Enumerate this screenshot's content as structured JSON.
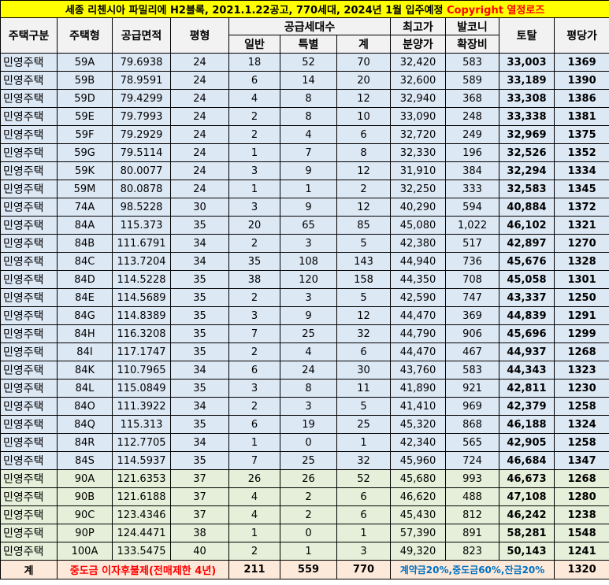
{
  "title": {
    "text": "세종 리첸시아 파밀리에 H2블록, 2021.1.22공고, 770세대, 2024년 1월 입주예정",
    "copyright": "Copyright 열정로즈"
  },
  "header": {
    "type": "주택구분",
    "model": "주택형",
    "area": "공급면적",
    "pyeong": "평형",
    "units": "공급세대수",
    "general": "일반",
    "special": "특별",
    "total_units": "계",
    "max_price_1": "최고가",
    "max_price_2": "분양가",
    "balcony_1": "발코니",
    "balcony_2": "확장비",
    "total": "토탈",
    "per_pyeong": "평당가"
  },
  "rows": [
    {
      "type": "민영주택",
      "model": "59A",
      "area": "79.6938",
      "pyeong": "24",
      "general": "18",
      "special": "52",
      "units": "70",
      "max_price": "32,420",
      "balcony": "583",
      "total": "33,003",
      "per_pyeong": "1369"
    },
    {
      "type": "민영주택",
      "model": "59B",
      "area": "78.9591",
      "pyeong": "24",
      "general": "6",
      "special": "14",
      "units": "20",
      "max_price": "32,600",
      "balcony": "589",
      "total": "33,189",
      "per_pyeong": "1390"
    },
    {
      "type": "민영주택",
      "model": "59D",
      "area": "79.4299",
      "pyeong": "24",
      "general": "4",
      "special": "8",
      "units": "12",
      "max_price": "32,940",
      "balcony": "368",
      "total": "33,308",
      "per_pyeong": "1386"
    },
    {
      "type": "민영주택",
      "model": "59E",
      "area": "79.7993",
      "pyeong": "24",
      "general": "2",
      "special": "8",
      "units": "10",
      "max_price": "33,090",
      "balcony": "248",
      "total": "33,338",
      "per_pyeong": "1381"
    },
    {
      "type": "민영주택",
      "model": "59F",
      "area": "79.2929",
      "pyeong": "24",
      "general": "2",
      "special": "4",
      "units": "6",
      "max_price": "32,720",
      "balcony": "249",
      "total": "32,969",
      "per_pyeong": "1375"
    },
    {
      "type": "민영주택",
      "model": "59G",
      "area": "79.5114",
      "pyeong": "24",
      "general": "1",
      "special": "7",
      "units": "8",
      "max_price": "32,330",
      "balcony": "196",
      "total": "32,526",
      "per_pyeong": "1352"
    },
    {
      "type": "민영주택",
      "model": "59K",
      "area": "80.0077",
      "pyeong": "24",
      "general": "3",
      "special": "9",
      "units": "12",
      "max_price": "31,910",
      "balcony": "384",
      "total": "32,294",
      "per_pyeong": "1334"
    },
    {
      "type": "민영주택",
      "model": "59M",
      "area": "80.0878",
      "pyeong": "24",
      "general": "1",
      "special": "1",
      "units": "2",
      "max_price": "32,250",
      "balcony": "333",
      "total": "32,583",
      "per_pyeong": "1345"
    },
    {
      "type": "민영주택",
      "model": "74A",
      "area": "98.5228",
      "pyeong": "30",
      "general": "3",
      "special": "9",
      "units": "12",
      "max_price": "40,290",
      "balcony": "594",
      "total": "40,884",
      "per_pyeong": "1372"
    },
    {
      "type": "민영주택",
      "model": "84A",
      "area": "115.373",
      "pyeong": "35",
      "general": "20",
      "special": "65",
      "units": "85",
      "max_price": "45,080",
      "balcony": "1,022",
      "total": "46,102",
      "per_pyeong": "1321"
    },
    {
      "type": "민영주택",
      "model": "84B",
      "area": "111.6791",
      "pyeong": "34",
      "general": "2",
      "special": "3",
      "units": "5",
      "max_price": "42,380",
      "balcony": "517",
      "total": "42,897",
      "per_pyeong": "1270"
    },
    {
      "type": "민영주택",
      "model": "84C",
      "area": "113.7204",
      "pyeong": "34",
      "general": "35",
      "special": "108",
      "units": "143",
      "max_price": "44,940",
      "balcony": "736",
      "total": "45,676",
      "per_pyeong": "1328"
    },
    {
      "type": "민영주택",
      "model": "84D",
      "area": "114.5228",
      "pyeong": "35",
      "general": "38",
      "special": "120",
      "units": "158",
      "max_price": "44,350",
      "balcony": "708",
      "total": "45,058",
      "per_pyeong": "1301"
    },
    {
      "type": "민영주택",
      "model": "84E",
      "area": "114.5689",
      "pyeong": "35",
      "general": "2",
      "special": "3",
      "units": "5",
      "max_price": "42,590",
      "balcony": "747",
      "total": "43,337",
      "per_pyeong": "1250"
    },
    {
      "type": "민영주택",
      "model": "84G",
      "area": "114.8389",
      "pyeong": "35",
      "general": "3",
      "special": "9",
      "units": "12",
      "max_price": "44,470",
      "balcony": "369",
      "total": "44,839",
      "per_pyeong": "1291"
    },
    {
      "type": "민영주택",
      "model": "84H",
      "area": "116.3208",
      "pyeong": "35",
      "general": "7",
      "special": "25",
      "units": "32",
      "max_price": "44,790",
      "balcony": "906",
      "total": "45,696",
      "per_pyeong": "1299"
    },
    {
      "type": "민영주택",
      "model": "84I",
      "area": "117.1747",
      "pyeong": "35",
      "general": "2",
      "special": "4",
      "units": "6",
      "max_price": "44,470",
      "balcony": "467",
      "total": "44,937",
      "per_pyeong": "1268"
    },
    {
      "type": "민영주택",
      "model": "84K",
      "area": "110.7965",
      "pyeong": "34",
      "general": "6",
      "special": "24",
      "units": "30",
      "max_price": "43,760",
      "balcony": "583",
      "total": "44,343",
      "per_pyeong": "1323"
    },
    {
      "type": "민영주택",
      "model": "84L",
      "area": "115.0849",
      "pyeong": "35",
      "general": "3",
      "special": "8",
      "units": "11",
      "max_price": "41,890",
      "balcony": "921",
      "total": "42,811",
      "per_pyeong": "1230"
    },
    {
      "type": "민영주택",
      "model": "84O",
      "area": "111.3922",
      "pyeong": "34",
      "general": "2",
      "special": "3",
      "units": "5",
      "max_price": "41,410",
      "balcony": "969",
      "total": "42,379",
      "per_pyeong": "1258"
    },
    {
      "type": "민영주택",
      "model": "84Q",
      "area": "115.313",
      "pyeong": "35",
      "general": "6",
      "special": "19",
      "units": "25",
      "max_price": "45,320",
      "balcony": "868",
      "total": "46,188",
      "per_pyeong": "1324"
    },
    {
      "type": "민영주택",
      "model": "84R",
      "area": "112.7705",
      "pyeong": "34",
      "general": "1",
      "special": "0",
      "units": "1",
      "max_price": "42,340",
      "balcony": "565",
      "total": "42,905",
      "per_pyeong": "1258"
    },
    {
      "type": "민영주택",
      "model": "84S",
      "area": "114.5937",
      "pyeong": "35",
      "general": "7",
      "special": "25",
      "units": "32",
      "max_price": "45,960",
      "balcony": "724",
      "total": "46,684",
      "per_pyeong": "1347"
    },
    {
      "type": "민영주택",
      "model": "90A",
      "area": "121.6353",
      "pyeong": "37",
      "general": "26",
      "special": "26",
      "units": "52",
      "max_price": "45,680",
      "balcony": "993",
      "total": "46,673",
      "per_pyeong": "1268"
    },
    {
      "type": "민영주택",
      "model": "90B",
      "area": "121.6188",
      "pyeong": "37",
      "general": "4",
      "special": "2",
      "units": "6",
      "max_price": "46,620",
      "balcony": "488",
      "total": "47,108",
      "per_pyeong": "1280"
    },
    {
      "type": "민영주택",
      "model": "90C",
      "area": "123.4346",
      "pyeong": "37",
      "general": "4",
      "special": "2",
      "units": "6",
      "max_price": "45,430",
      "balcony": "812",
      "total": "46,242",
      "per_pyeong": "1238"
    },
    {
      "type": "민영주택",
      "model": "90P",
      "area": "124.4471",
      "pyeong": "38",
      "general": "1",
      "special": "0",
      "units": "1",
      "max_price": "57,390",
      "balcony": "891",
      "total": "58,281",
      "per_pyeong": "1548"
    },
    {
      "type": "민영주택",
      "model": "100A",
      "area": "133.5475",
      "pyeong": "40",
      "general": "2",
      "special": "1",
      "units": "3",
      "max_price": "49,320",
      "balcony": "823",
      "total": "50,143",
      "per_pyeong": "1241"
    }
  ],
  "footer": {
    "label": "계",
    "note": "중도금 이자후불제(전매제한 4년)",
    "general": "211",
    "special": "559",
    "units": "770",
    "payment": "계약금20%,중도금60%,잔금20%",
    "per_pyeong": "1320"
  },
  "colors": {
    "title_bg": "#ffff00",
    "copyright": "#ff0000",
    "header_bg": "#f2f2f2",
    "row_blue": "#dde8f5",
    "row_green": "#e6efd9",
    "footer_bg": "#fde9d9",
    "footer_note": "#ff0000",
    "footer_payment": "#0070c0"
  }
}
